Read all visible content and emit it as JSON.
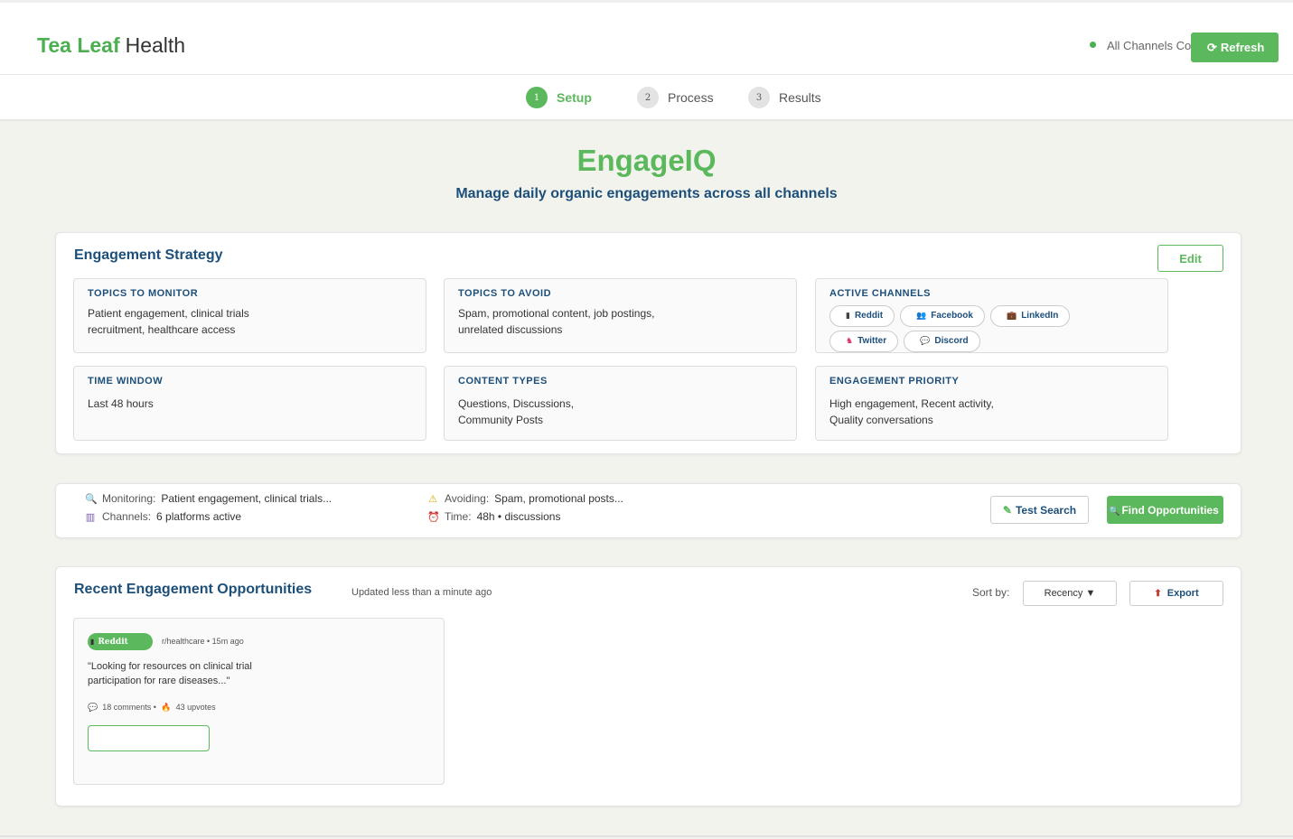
{
  "header": {
    "brand_primary": "Tea Leaf",
    "brand_secondary": "Health",
    "status_text": "All Channels Connected",
    "refresh_icon": "refresh-icon",
    "refresh_label": "Refresh"
  },
  "steps": [
    {
      "num": "1",
      "label": "Setup"
    },
    {
      "num": "2",
      "label": "Process"
    },
    {
      "num": "3",
      "label": "Results"
    }
  ],
  "hero": {
    "title": "EngageIQ",
    "subtitle": "Manage daily organic engagements across all channels"
  },
  "strategy": {
    "title": "Engagement Strategy",
    "edit_label": "Edit",
    "topics_monitor": {
      "heading": "TOPICS TO MONITOR",
      "text": "Patient engagement, clinical trials recruitment, healthcare access"
    },
    "topics_avoid": {
      "heading": "TOPICS TO AVOID",
      "text": "Spam, promotional content, job postings, unrelated discussions"
    },
    "active_channels": {
      "heading": "ACTIVE CHANNELS",
      "channels": [
        {
          "label": "Reddit",
          "icon": "reddit-icon",
          "glyph": "▮",
          "color": "#444444"
        },
        {
          "label": "Facebook",
          "icon": "facebook-icon",
          "glyph": "👥",
          "color": "#4a4a8a"
        },
        {
          "label": "LinkedIn",
          "icon": "linkedin-icon",
          "glyph": "💼",
          "color": "#7a4a2a"
        },
        {
          "label": "Twitter",
          "icon": "twitter-icon",
          "glyph": "♞",
          "color": "#d6336c"
        },
        {
          "label": "Discord",
          "icon": "discord-icon",
          "glyph": "💬",
          "color": "#9aa0b0"
        }
      ]
    },
    "time_window": {
      "heading": "TIME WINDOW",
      "text": "Last 48 hours"
    },
    "content_types": {
      "heading": "CONTENT TYPES",
      "text": "Questions, Discussions, Community Posts"
    },
    "engagement_priority": {
      "heading": "ENGAGEMENT PRIORITY",
      "text": "High engagement, Recent activity, Quality conversations"
    }
  },
  "summary": {
    "monitoring_label": "Monitoring:",
    "monitoring_value": "Patient engagement, clinical trials...",
    "channels_label": "Channels:",
    "channels_value": "6 platforms active",
    "avoiding_label": "Avoiding:",
    "avoiding_value": "Spam, promotional posts...",
    "time_label": "Time:",
    "time_value": "48h • discussions",
    "test_label": "Test Search",
    "find_label": "Find Opportunities"
  },
  "opportunities": {
    "title": "Recent Engagement Opportunities",
    "updated": "Updated less than a minute ago",
    "sort_label": "Sort by:",
    "sort_value": "Recency ▼",
    "export_label": "Export",
    "items": [
      {
        "platform": "Reddit",
        "meta": "r/healthcare • 15m ago",
        "quote": "\"Looking for resources on clinical trial participation for rare diseases...\"",
        "stats_comments": "18 comments •",
        "stats_upvotes": "43 upvotes"
      }
    ]
  },
  "colors": {
    "accent": "#5cb85c",
    "navy": "#1c4f7a",
    "background": "#f3f3ee"
  }
}
